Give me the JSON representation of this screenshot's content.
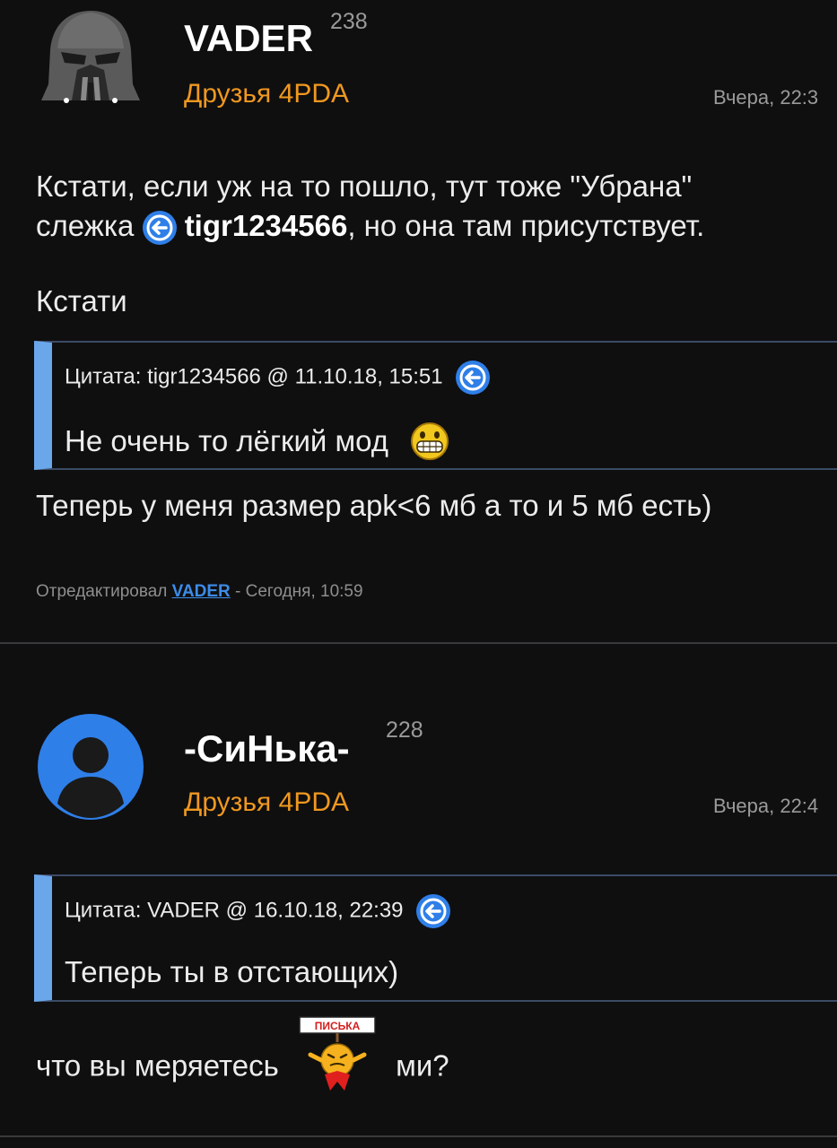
{
  "posts": [
    {
      "author": "VADER",
      "reputation": "238",
      "group": "Друзья 4PDA",
      "date": "Вчера, 22:3",
      "text_line1": "Кстати, если уж на то пошло, тут тоже \"Убрана\"",
      "text_line2_before": "слежка",
      "text_line2_mention": "tigr1234566",
      "text_line2_after": ", но она там присутствует.",
      "text_line3": "Кстати",
      "quote": {
        "header": "Цитата: tigr1234566 @ 11.10.18, 15:51",
        "body": "Не очень то лёгкий мод"
      },
      "text_after_quote": "Теперь у меня размер apk<6 мб а то и 5 мб есть)",
      "edited_prefix": "Отредактировал",
      "edited_by": "VADER",
      "edited_suffix": "- Сегодня, 10:59"
    },
    {
      "author": "-СиНька-",
      "reputation": "228",
      "group": "Друзья 4PDA",
      "date": "Вчера, 22:4",
      "quote": {
        "header": "Цитата: VADER @ 16.10.18, 22:39",
        "body": "Теперь ты в отстающих)"
      },
      "text_before_smile": "что вы меряетесь",
      "smile_caption": "ПИСЬКА",
      "text_after_smile": "ми?"
    }
  ],
  "colors": {
    "background": "#0f0f10",
    "group": "#f0981f",
    "quote_bar": "#6aa6ea",
    "link": "#3d8ce8",
    "back_icon": "#2f7fe8"
  }
}
